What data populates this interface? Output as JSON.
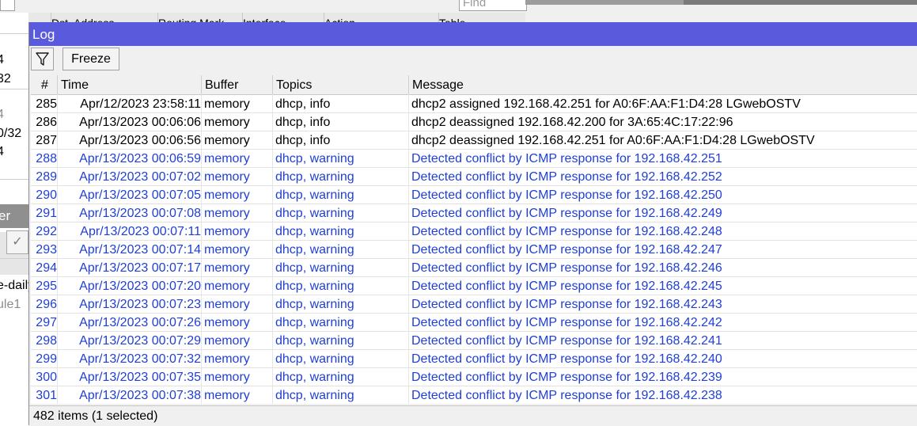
{
  "background": {
    "find_placeholder": "Find",
    "column_headers": [
      "Dst. Address",
      "Routing Mark",
      "Interface",
      "Action",
      "Table"
    ],
    "sidebar_fragments": [
      {
        "text": "4",
        "muted": false
      },
      {
        "text": "32",
        "muted": false
      },
      {
        "text": "4",
        "muted": true
      },
      {
        "text": "0/32",
        "muted": false
      },
      {
        "text": "4",
        "muted": false
      }
    ],
    "panel_label": "er",
    "list_fragments": [
      {
        "text": "e-daily",
        "muted": false
      },
      {
        "text": "ule1",
        "muted": true
      }
    ]
  },
  "log": {
    "title": "Log",
    "toolbar": {
      "filter_icon": "funnel-icon",
      "freeze_label": "Freeze"
    },
    "columns": [
      "#",
      "Time",
      "Buffer",
      "Topics",
      "Message"
    ],
    "rows": [
      {
        "num": "285",
        "time": "Apr/12/2023 23:58:11",
        "buffer": "memory",
        "topics": "dhcp, info",
        "message": "dhcp2 assigned 192.168.42.251 for A0:6F:AA:F1:D4:28 LGwebOSTV",
        "level": "info"
      },
      {
        "num": "286",
        "time": "Apr/13/2023 00:06:06",
        "buffer": "memory",
        "topics": "dhcp, info",
        "message": "dhcp2 deassigned 192.168.42.200 for 3A:65:4C:17:22:96",
        "level": "info"
      },
      {
        "num": "287",
        "time": "Apr/13/2023 00:06:56",
        "buffer": "memory",
        "topics": "dhcp, info",
        "message": "dhcp2 deassigned 192.168.42.251 for A0:6F:AA:F1:D4:28 LGwebOSTV",
        "level": "info"
      },
      {
        "num": "288",
        "time": "Apr/13/2023 00:06:59",
        "buffer": "memory",
        "topics": "dhcp, warning",
        "message": "Detected conflict by ICMP response for 192.168.42.251",
        "level": "warning"
      },
      {
        "num": "289",
        "time": "Apr/13/2023 00:07:02",
        "buffer": "memory",
        "topics": "dhcp, warning",
        "message": "Detected conflict by ICMP response for 192.168.42.252",
        "level": "warning"
      },
      {
        "num": "290",
        "time": "Apr/13/2023 00:07:05",
        "buffer": "memory",
        "topics": "dhcp, warning",
        "message": "Detected conflict by ICMP response for 192.168.42.250",
        "level": "warning"
      },
      {
        "num": "291",
        "time": "Apr/13/2023 00:07:08",
        "buffer": "memory",
        "topics": "dhcp, warning",
        "message": "Detected conflict by ICMP response for 192.168.42.249",
        "level": "warning"
      },
      {
        "num": "292",
        "time": "Apr/13/2023 00:07:11",
        "buffer": "memory",
        "topics": "dhcp, warning",
        "message": "Detected conflict by ICMP response for 192.168.42.248",
        "level": "warning"
      },
      {
        "num": "293",
        "time": "Apr/13/2023 00:07:14",
        "buffer": "memory",
        "topics": "dhcp, warning",
        "message": "Detected conflict by ICMP response for 192.168.42.247",
        "level": "warning"
      },
      {
        "num": "294",
        "time": "Apr/13/2023 00:07:17",
        "buffer": "memory",
        "topics": "dhcp, warning",
        "message": "Detected conflict by ICMP response for 192.168.42.246",
        "level": "warning"
      },
      {
        "num": "295",
        "time": "Apr/13/2023 00:07:20",
        "buffer": "memory",
        "topics": "dhcp, warning",
        "message": "Detected conflict by ICMP response for 192.168.42.245",
        "level": "warning"
      },
      {
        "num": "296",
        "time": "Apr/13/2023 00:07:23",
        "buffer": "memory",
        "topics": "dhcp, warning",
        "message": "Detected conflict by ICMP response for 192.168.42.243",
        "level": "warning"
      },
      {
        "num": "297",
        "time": "Apr/13/2023 00:07:26",
        "buffer": "memory",
        "topics": "dhcp, warning",
        "message": "Detected conflict by ICMP response for 192.168.42.242",
        "level": "warning"
      },
      {
        "num": "298",
        "time": "Apr/13/2023 00:07:29",
        "buffer": "memory",
        "topics": "dhcp, warning",
        "message": "Detected conflict by ICMP response for 192.168.42.241",
        "level": "warning"
      },
      {
        "num": "299",
        "time": "Apr/13/2023 00:07:32",
        "buffer": "memory",
        "topics": "dhcp, warning",
        "message": "Detected conflict by ICMP response for 192.168.42.240",
        "level": "warning"
      },
      {
        "num": "300",
        "time": "Apr/13/2023 00:07:35",
        "buffer": "memory",
        "topics": "dhcp, warning",
        "message": "Detected conflict by ICMP response for 192.168.42.239",
        "level": "warning"
      },
      {
        "num": "301",
        "time": "Apr/13/2023 00:07:38",
        "buffer": "memory",
        "topics": "dhcp, warning",
        "message": "Detected conflict by ICMP response for 192.168.42.238",
        "level": "warning"
      }
    ],
    "status": "482 items (1 selected)"
  },
  "colors": {
    "title_bar": "#5a5add",
    "info_text": "#000000",
    "warning_text": "#1f3fd6",
    "muted_text": "#8c8c8c"
  }
}
